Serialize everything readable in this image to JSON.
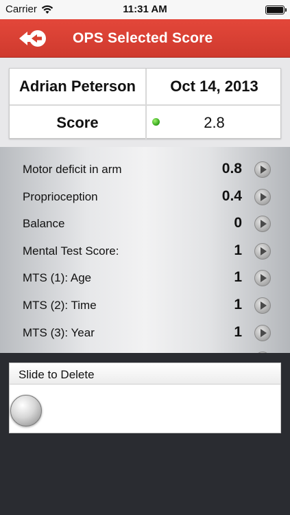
{
  "status_bar": {
    "carrier": "Carrier",
    "time": "11:31 AM"
  },
  "nav": {
    "title": "OPS Selected Score",
    "back_icon": "back-arrow-icon",
    "accent_color": "#d8402f"
  },
  "summary": {
    "patient_name": "Adrian Peterson",
    "date": "Oct 14, 2013",
    "score_label": "Score",
    "score_value": "2.8",
    "score_status_color": "#3cb320"
  },
  "metrics": [
    {
      "label": "Motor deficit in arm",
      "value": "0.8"
    },
    {
      "label": "Proprioception",
      "value": "0.4"
    },
    {
      "label": "Balance",
      "value": "0"
    },
    {
      "label": "Mental Test Score:",
      "value": "1"
    },
    {
      "label": "MTS (1): Age",
      "value": "1"
    },
    {
      "label": "MTS (2): Time",
      "value": "1"
    },
    {
      "label": "MTS (3): Year",
      "value": "1"
    }
  ],
  "delete_panel": {
    "label": "Slide to Delete"
  }
}
